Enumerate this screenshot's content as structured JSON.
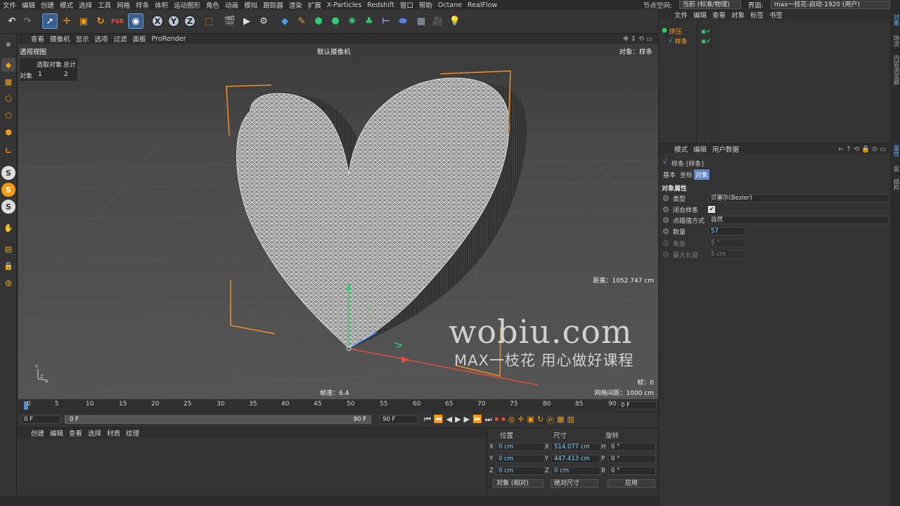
{
  "menu": [
    "文件",
    "编辑",
    "创建",
    "模式",
    "选择",
    "工具",
    "网格",
    "样条",
    "体积",
    "运动图形",
    "角色",
    "动画",
    "模拟",
    "跟踪器",
    "渲染",
    "扩展",
    "X-Particles",
    "Redshift",
    "窗口",
    "帮助",
    "Octane",
    "RealFlow"
  ],
  "menu_right": {
    "node_space_label": "节点空间:",
    "node_space_value": "当前 (标准/物理)",
    "layout_label": "界面:",
    "layout_value": "max一枝花-启动-1920 (用户)"
  },
  "viewport": {
    "menu": [
      "查看",
      "摄像机",
      "显示",
      "选项",
      "过滤",
      "面板",
      "ProRender"
    ],
    "view_name": "透视视图",
    "camera": "默认摄像机",
    "object_label": "对象：样条",
    "stats_header": [
      "选取对象",
      "总计"
    ],
    "stats_row_label": "对象",
    "stats_selected": "1",
    "stats_total": "2",
    "distance": "距离：1052.747 cm",
    "fps": "帧速：6.4",
    "frame": "帧：0",
    "grid": "网格间距：1000 cm",
    "watermark_main": "wobiu.com",
    "watermark_sub": "MAX一枝花  用心做好课程"
  },
  "timeline": {
    "ticks": [
      "0",
      "5",
      "10",
      "15",
      "20",
      "25",
      "30",
      "35",
      "40",
      "45",
      "50",
      "55",
      "60",
      "65",
      "70",
      "75",
      "80",
      "85",
      "90"
    ],
    "current_field": "0 F"
  },
  "playbar": {
    "start": "0 F",
    "range_start": "0 F",
    "range_end": "90 F",
    "end": "90 F"
  },
  "material_menu": [
    "创建",
    "编辑",
    "查看",
    "选择",
    "材质",
    "纹理"
  ],
  "coords": {
    "headers": [
      "位置",
      "尺寸",
      "旋转"
    ],
    "rows": [
      {
        "axis": "X",
        "pos": "0 cm",
        "size_axis": "X",
        "size": "514.077 cm",
        "rot_axis": "H",
        "rot": "0 °"
      },
      {
        "axis": "Y",
        "pos": "0 cm",
        "size_axis": "Y",
        "size": "447.413 cm",
        "rot_axis": "P",
        "rot": "0 °"
      },
      {
        "axis": "Z",
        "pos": "0 cm",
        "size_axis": "Z",
        "size": "0 cm",
        "rot_axis": "B",
        "rot": "0 °"
      }
    ],
    "mode_dropdown": "对象 (相对)",
    "size_dropdown": "绝对尺寸",
    "apply_label": "应用"
  },
  "objects": {
    "menu": [
      "文件",
      "编辑",
      "查看",
      "对象",
      "标签",
      "书签"
    ],
    "items": [
      {
        "name": "挤压",
        "color": "#f5a623"
      },
      {
        "name": "样条",
        "color": "#f5a623"
      }
    ]
  },
  "attributes": {
    "menu": [
      "模式",
      "编辑",
      "用户数据"
    ],
    "title": "样条 [样条]",
    "tabs": [
      "基本",
      "坐标",
      "对象"
    ],
    "active_tab": "对象",
    "section": "对象属性",
    "type_label": "类型",
    "type_value": "贝塞尔(Bezier)",
    "closed_label": "闭合样条",
    "interp_label": "点插值方式",
    "interp_value": "自然",
    "count_label": "数量",
    "count_value": "57",
    "angle_label": "角度",
    "angle_value": "5 °",
    "maxlen_label": "最大长度",
    "maxlen_value": "5 cm"
  },
  "right_strip": [
    "对象",
    "场次",
    "内容浏览器",
    "属性",
    "层",
    "结构"
  ]
}
